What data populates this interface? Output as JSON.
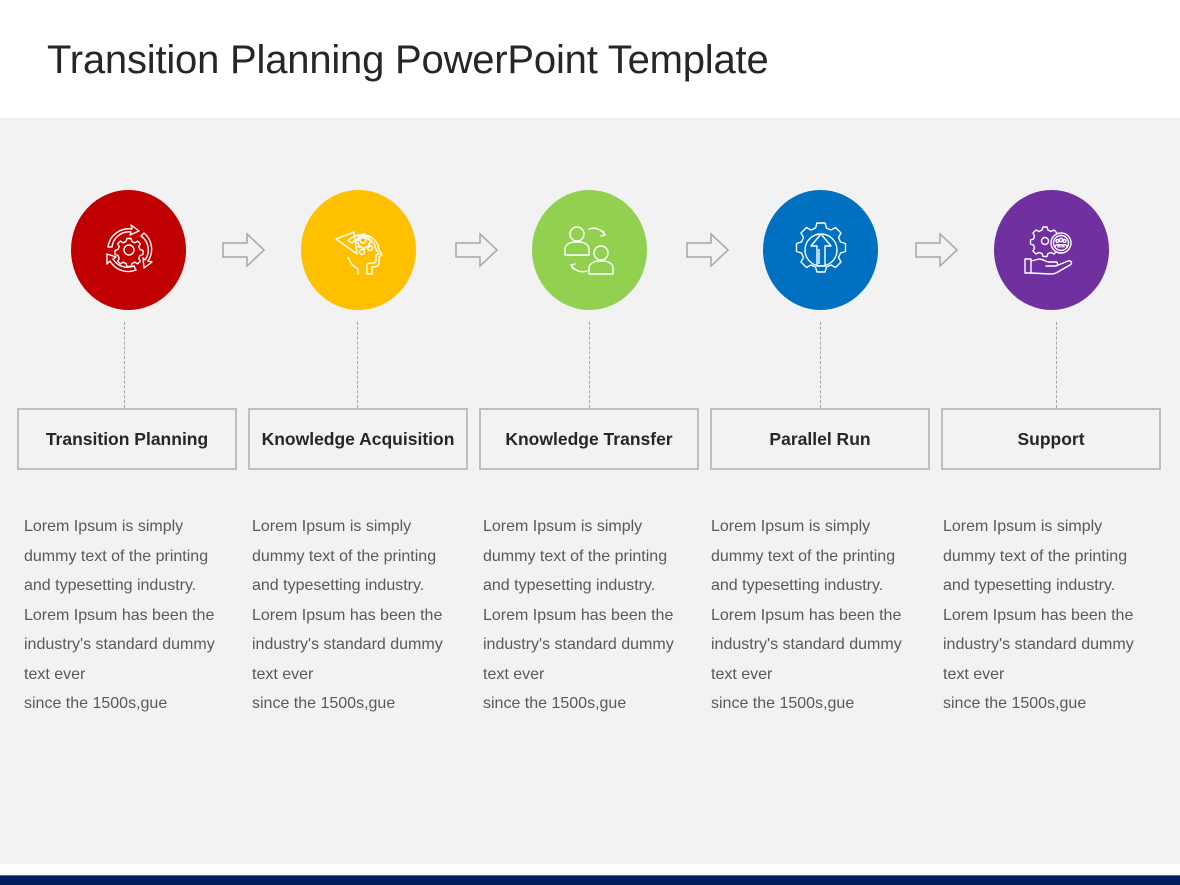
{
  "slide": {
    "title": "Transition Planning PowerPoint Template"
  },
  "colors": {
    "background_panel": "#f2f2f2",
    "footer_bar": "#001f5c",
    "title_text": "#262626",
    "body_text": "#595959",
    "box_border": "#bfbfbf"
  },
  "steps": [
    {
      "label": "Transition Planning",
      "icon": "cycle-gear-icon",
      "color": "#c00000",
      "description": [
        "Lorem Ipsum is simply",
        "dummy text of the printing",
        "and typesetting industry.",
        "Lorem Ipsum has been the",
        "industry's standard dummy",
        "text ever",
        "since the 1500s,gue"
      ]
    },
    {
      "label": "Knowledge Acquisition",
      "icon": "head-gears-icon",
      "color": "#ffc000",
      "description": [
        "Lorem Ipsum is simply",
        "dummy text of the printing",
        "and typesetting industry.",
        "Lorem Ipsum has been the",
        "industry's standard dummy",
        "text ever",
        "since the 1500s,gue"
      ]
    },
    {
      "label": "Knowledge Transfer",
      "icon": "people-exchange-icon",
      "color": "#92d050",
      "description": [
        "Lorem Ipsum is simply",
        "dummy text of the printing",
        "and typesetting industry.",
        "Lorem Ipsum has been the",
        "industry's standard dummy",
        "text ever",
        "since the 1500s,gue"
      ]
    },
    {
      "label": "Parallel Run",
      "icon": "gear-arrow-up-icon",
      "color": "#0070c0",
      "description": [
        "Lorem Ipsum is simply",
        "dummy text of the printing",
        "and typesetting industry.",
        "Lorem Ipsum has been the",
        "industry's standard dummy",
        "text ever",
        "since the 1500s,gue"
      ]
    },
    {
      "label": "Support",
      "icon": "hand-gear-team-icon",
      "color": "#7030a0",
      "description": [
        "Lorem Ipsum is simply",
        "dummy text of the printing",
        "and typesetting industry.",
        "Lorem Ipsum has been the",
        "industry's standard dummy",
        "text ever",
        "since the 1500s,gue"
      ]
    }
  ]
}
